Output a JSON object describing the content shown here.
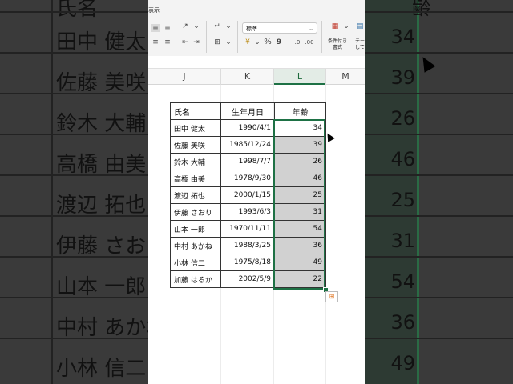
{
  "ribbon": {
    "tab_display": "表示",
    "number_format": "標準",
    "currency_icon": "¥",
    "percent_label": "%",
    "comma_label": "9",
    "cond_format_line1": "条件付き",
    "cond_format_line2": "書式",
    "table_line1": "テー",
    "table_line2": "して"
  },
  "columns": [
    "J",
    "K",
    "L",
    "M"
  ],
  "table": {
    "headers": [
      "氏名",
      "生年月日",
      "年齢"
    ],
    "rows": [
      {
        "name": "田中 健太",
        "date": "1990/4/1",
        "age": "34"
      },
      {
        "name": "佐藤 美咲",
        "date": "1985/12/24",
        "age": "39"
      },
      {
        "name": "鈴木 大輔",
        "date": "1998/7/7",
        "age": "26"
      },
      {
        "name": "高橋 由美",
        "date": "1978/9/30",
        "age": "46"
      },
      {
        "name": "渡辺 拓也",
        "date": "2000/1/15",
        "age": "25"
      },
      {
        "name": "伊藤 さおり",
        "date": "1993/6/3",
        "age": "31"
      },
      {
        "name": "山本 一郎",
        "date": "1970/11/11",
        "age": "54"
      },
      {
        "name": "中村 あかね",
        "date": "1988/3/25",
        "age": "36"
      },
      {
        "name": "小林 信二",
        "date": "1975/8/18",
        "age": "49"
      },
      {
        "name": "加藤 はるか",
        "date": "2002/5/9",
        "age": "22"
      }
    ]
  },
  "zoom_bg": {
    "header_left": "氏名",
    "header_right": "齢",
    "names": [
      "田中 健太",
      "佐藤 美咲",
      "鈴木 大輔",
      "高橋 由美",
      "渡辺 拓也",
      "伊藤 さおり",
      "山本 一郎",
      "中村 あかね",
      "小林 信二"
    ],
    "ages": [
      "34",
      "39",
      "26",
      "46",
      "25",
      "31",
      "54",
      "36",
      "49"
    ]
  }
}
